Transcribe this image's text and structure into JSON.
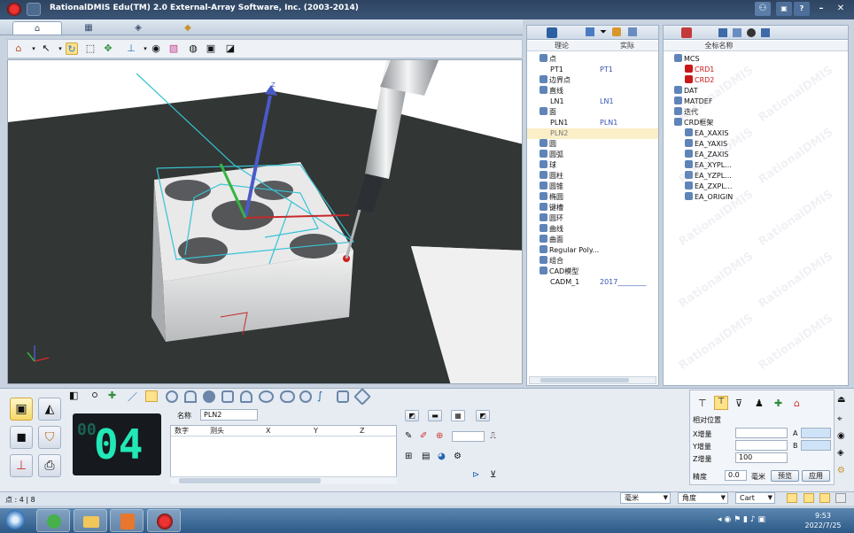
{
  "window": {
    "title": "RationalDMIS Edu(TM) 2.0    External-Array Software, Inc. (2003-2014)"
  },
  "columns": {
    "theory": "理论",
    "actual": "实际",
    "full_name": "全标名称"
  },
  "feature_tree": [
    {
      "label": "点",
      "level": 0,
      "icon": "point-icon"
    },
    {
      "label": "PT1",
      "value": "PT1",
      "level": 1
    },
    {
      "label": "边界点",
      "level": 0,
      "icon": "boundary-point-icon"
    },
    {
      "label": "直线",
      "level": 0,
      "icon": "line-icon"
    },
    {
      "label": "LN1",
      "value": "LN1",
      "level": 1
    },
    {
      "label": "面",
      "level": 0,
      "icon": "plane-icon"
    },
    {
      "label": "PLN1",
      "value": "PLN1",
      "level": 1
    },
    {
      "label": "PLN2",
      "value": "",
      "level": 1,
      "selected": true
    },
    {
      "label": "圆",
      "level": 0,
      "icon": "circle-icon"
    },
    {
      "label": "圆弧",
      "level": 0,
      "icon": "arc-icon"
    },
    {
      "label": "球",
      "level": 0,
      "icon": "sphere-icon"
    },
    {
      "label": "圆柱",
      "level": 0,
      "icon": "cylinder-icon"
    },
    {
      "label": "圆锥",
      "level": 0,
      "icon": "cone-icon"
    },
    {
      "label": "椭圆",
      "level": 0,
      "icon": "ellipse-icon"
    },
    {
      "label": "键槽",
      "level": 0,
      "icon": "slot-icon"
    },
    {
      "label": "圆环",
      "level": 0,
      "icon": "torus-icon"
    },
    {
      "label": "曲线",
      "level": 0,
      "icon": "curve-icon"
    },
    {
      "label": "曲面",
      "level": 0,
      "icon": "surface-icon"
    },
    {
      "label": "Regular Poly...",
      "level": 0,
      "icon": "polygon-icon"
    },
    {
      "label": "组合",
      "level": 0,
      "icon": "group-icon"
    },
    {
      "label": "CAD模型",
      "level": 0,
      "icon": "cad-model-icon"
    },
    {
      "label": "CADM_1",
      "value": "2017________",
      "level": 1
    }
  ],
  "coord_tree": [
    {
      "label": "MCS",
      "level": 0
    },
    {
      "label": "CRD1",
      "level": 1,
      "red": true
    },
    {
      "label": "CRD2",
      "level": 1,
      "red": true
    },
    {
      "label": "DAT",
      "level": 0
    },
    {
      "label": "MATDEF",
      "level": 0
    },
    {
      "label": "迭代",
      "level": 0
    },
    {
      "label": "CRD框架",
      "level": 0
    },
    {
      "label": "EA_XAXIS",
      "level": 1
    },
    {
      "label": "EA_YAXIS",
      "level": 1
    },
    {
      "label": "EA_ZAXIS",
      "level": 1
    },
    {
      "label": "EA_XYPL...",
      "level": 1
    },
    {
      "label": "EA_YZPL...",
      "level": 1
    },
    {
      "label": "EA_ZXPL...",
      "level": 1
    },
    {
      "label": "EA_ORIGIN",
      "level": 1
    }
  ],
  "watermark": "RationalDMIS",
  "counter": {
    "small": "00",
    "big": "04"
  },
  "feature_name": {
    "label": "名称",
    "value": "PLN2"
  },
  "grid_headers": [
    "数字",
    "测头",
    "X",
    "Y",
    "Z"
  ],
  "relative_position": {
    "title": "相对位置",
    "x_label": "X增量",
    "y_label": "Y增量",
    "z_label": "Z增量",
    "z_value": "100",
    "a_label": "A",
    "b_label": "B",
    "accuracy_label": "精度",
    "accuracy_value": "0.0",
    "unit": "毫米",
    "preview_button": "预览",
    "apply_button": "应用"
  },
  "status": {
    "left": "点 : 4 | 8",
    "unit_select": "毫米",
    "angle_select": "角度",
    "coord_select": "Cart"
  },
  "clock": {
    "time": "9:53",
    "date": "2022/7/25"
  },
  "colors": {
    "counter_digits": "#22e8b7",
    "selected_row": "#fbefc7",
    "crd_red": "#c81818"
  }
}
